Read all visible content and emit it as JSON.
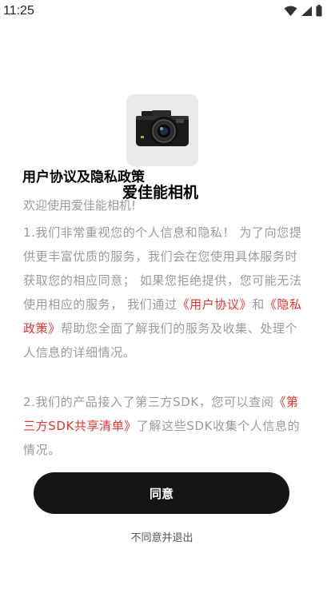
{
  "status_bar": {
    "time": "11:25"
  },
  "dialog": {
    "title": "用户协议及隐私政策",
    "app_name": "爱佳能相机",
    "welcome": "欢迎使用爱佳能相机!",
    "para1": {
      "text_a": "1.我们非常重视您的个人信息和隐私！ 为了向您提供更丰富优质的服务，我们会在您使用具体服务时获取您的相应同意； 如果您拒绝提供，您可能无法使用相应的服务， 我们通过",
      "link_user_agreement": "《用户协议》",
      "text_b": "和",
      "link_privacy_policy": "《隐私政策》",
      "text_c": "帮助您全面了解我们的服务及收集、处理个人信息的详细情况。"
    },
    "para2": {
      "text_a": "2.我们的产品接入了第三方SDK，您可以查阅",
      "link_sdk_list": "《第三方SDK共享清单》",
      "text_b": "了解这些SDK收集个人信息的情况。"
    },
    "agree_label": "同意",
    "disagree_label": "不同意并退出"
  }
}
